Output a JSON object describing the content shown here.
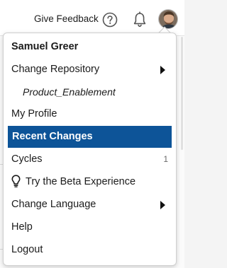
{
  "header": {
    "feedback_label": "Give Feedback",
    "help_icon": "help-circle-icon",
    "notifications_icon": "bell-icon",
    "avatar_icon": "user-avatar"
  },
  "menu": {
    "user_name": "Samuel Greer",
    "change_repository": "Change Repository",
    "current_repository": "Product_Enablement",
    "my_profile": "My Profile",
    "recent_changes": "Recent Changes",
    "cycles": "Cycles",
    "cycles_count": "1",
    "beta": "Try the Beta Experience",
    "change_language": "Change Language",
    "help": "Help",
    "logout": "Logout",
    "active_item": "Recent Changes",
    "active_color": "#0d5498"
  }
}
